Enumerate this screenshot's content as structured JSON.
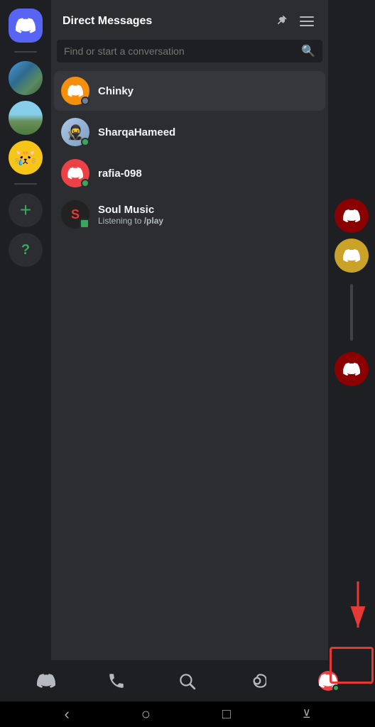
{
  "header": {
    "title": "Direct Messages",
    "menu_label": "menu"
  },
  "search": {
    "placeholder": "Find or start a conversation"
  },
  "dm_list": [
    {
      "id": "chinky",
      "name": "Chinky",
      "status": "offline",
      "avatar_color": "#f4900c",
      "avatar_type": "discord",
      "active": true
    },
    {
      "id": "sharqa",
      "name": "SharqaHameed",
      "status": "online",
      "avatar_color": "#4f545c",
      "avatar_type": "discord",
      "active": false
    },
    {
      "id": "rafia",
      "name": "rafia-098",
      "status": "dnd",
      "avatar_color": "#ed4245",
      "avatar_type": "discord",
      "active": false
    },
    {
      "id": "soul",
      "name": "Soul Music",
      "sub": "Listening to /play",
      "sub_cmd": "/play",
      "status": "gaming",
      "avatar_color": "#1a1a1a",
      "avatar_type": "music",
      "active": false
    }
  ],
  "right_servers": [
    {
      "id": "srv1",
      "color": "#8b0000",
      "type": "discord"
    },
    {
      "id": "srv2",
      "color": "#c9a227",
      "type": "discord"
    },
    {
      "id": "srv3",
      "color": "#8b0000",
      "type": "discord"
    }
  ],
  "bottom_nav": {
    "items": [
      {
        "id": "home",
        "label": "Home",
        "icon": "discord"
      },
      {
        "id": "friends",
        "label": "Friends",
        "icon": "friends"
      },
      {
        "id": "search",
        "label": "Search",
        "icon": "search"
      },
      {
        "id": "mention",
        "label": "Mentions",
        "icon": "at"
      },
      {
        "id": "profile",
        "label": "Profile",
        "icon": "avatar",
        "active": true
      }
    ]
  },
  "system_bar": {
    "back": "‹",
    "home": "○",
    "recent": "□",
    "menu": "⊻"
  },
  "annotation": {
    "arrow_text": "↓"
  }
}
